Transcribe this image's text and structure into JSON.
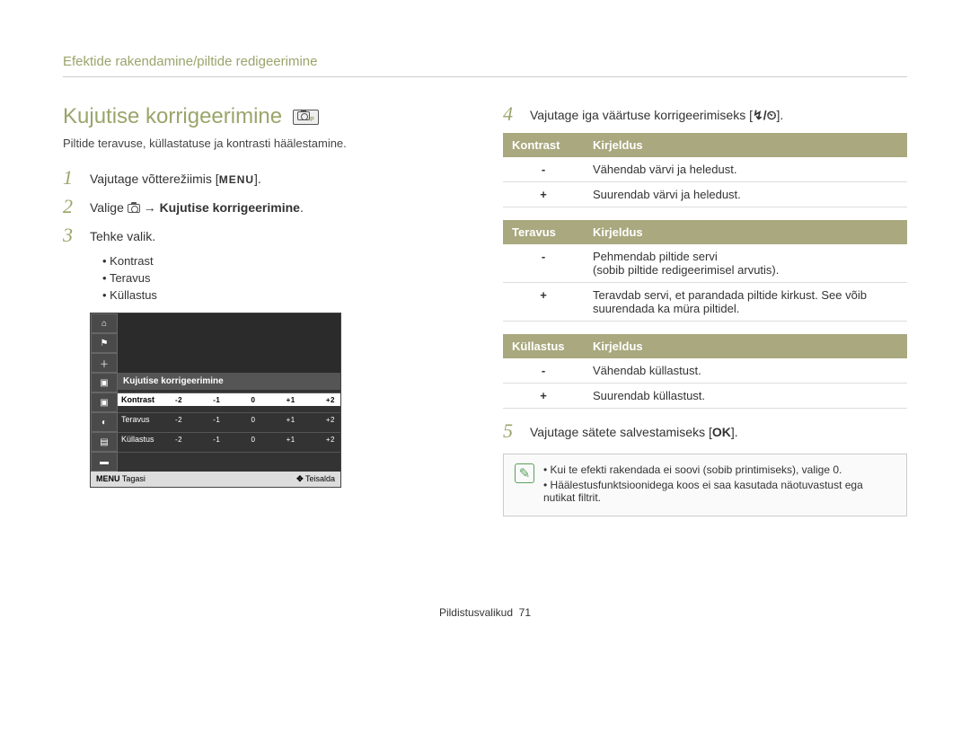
{
  "header": "Efektide rakendamine/piltide redigeerimine",
  "title": "Kujutise korrigeerimine",
  "subtitle": "Piltide teravuse, küllastatuse ja kontrasti häälestamine.",
  "steps": {
    "s1_pre": "Vajutage võtterežiimis [",
    "s1_btn": "MENU",
    "s1_post": "].",
    "s2_pre": "Valige ",
    "s2_arrow": " → ",
    "s2_bold": "Kujutise korrigeerimine",
    "s2_post": ".",
    "s3": "Tehke valik.",
    "s4_pre": "Vajutage iga väärtuse korrigeerimiseks [",
    "s4_icons": "↯/⏲",
    "s4_post": "].",
    "s5_pre": "Vajutage sätete salvestamiseks [",
    "s5_btn": "OK",
    "s5_post": "]."
  },
  "step_nums": {
    "n1": "1",
    "n2": "2",
    "n3": "3",
    "n4": "4",
    "n5": "5"
  },
  "bullets": [
    "Kontrast",
    "Teravus",
    "Küllastus"
  ],
  "screen": {
    "title": "Kujutise korrigeerimine",
    "rows": [
      "Kontrast",
      "Teravus",
      "Küllastus"
    ],
    "ticks": [
      "-2",
      "-1",
      "0",
      "+1",
      "+2"
    ],
    "footer_left_icon": "MENU",
    "footer_left": "Tagasi",
    "footer_right_icon": "✥",
    "footer_right": "Teisalda",
    "side_plus": "＋"
  },
  "tables": {
    "kontrast": {
      "h1": "Kontrast",
      "h2": "Kirjeldus",
      "r1k": "-",
      "r1v": "Vähendab värvi ja heledust.",
      "r2k": "+",
      "r2v": "Suurendab värvi ja heledust."
    },
    "teravus": {
      "h1": "Teravus",
      "h2": "Kirjeldus",
      "r1k": "-",
      "r1v": "Pehmendab piltide servi\n(sobib piltide redigeerimisel arvutis).",
      "r2k": "+",
      "r2v": "Teravdab servi, et parandada piltide kirkust. See võib suurendada ka müra piltidel."
    },
    "kyllastus": {
      "h1": "Küllastus",
      "h2": "Kirjeldus",
      "r1k": "-",
      "r1v": "Vähendab küllastust.",
      "r2k": "+",
      "r2v": "Suurendab küllastust."
    }
  },
  "notes": [
    "Kui te efekti rakendada ei soovi (sobib printimiseks), valige 0.",
    "Häälestusfunktsioonidega koos ei saa kasutada näotuvastust ega nutikat filtrit."
  ],
  "footer_label": "Pildistusvalikud",
  "footer_page": "71",
  "note_glyph": "✎"
}
